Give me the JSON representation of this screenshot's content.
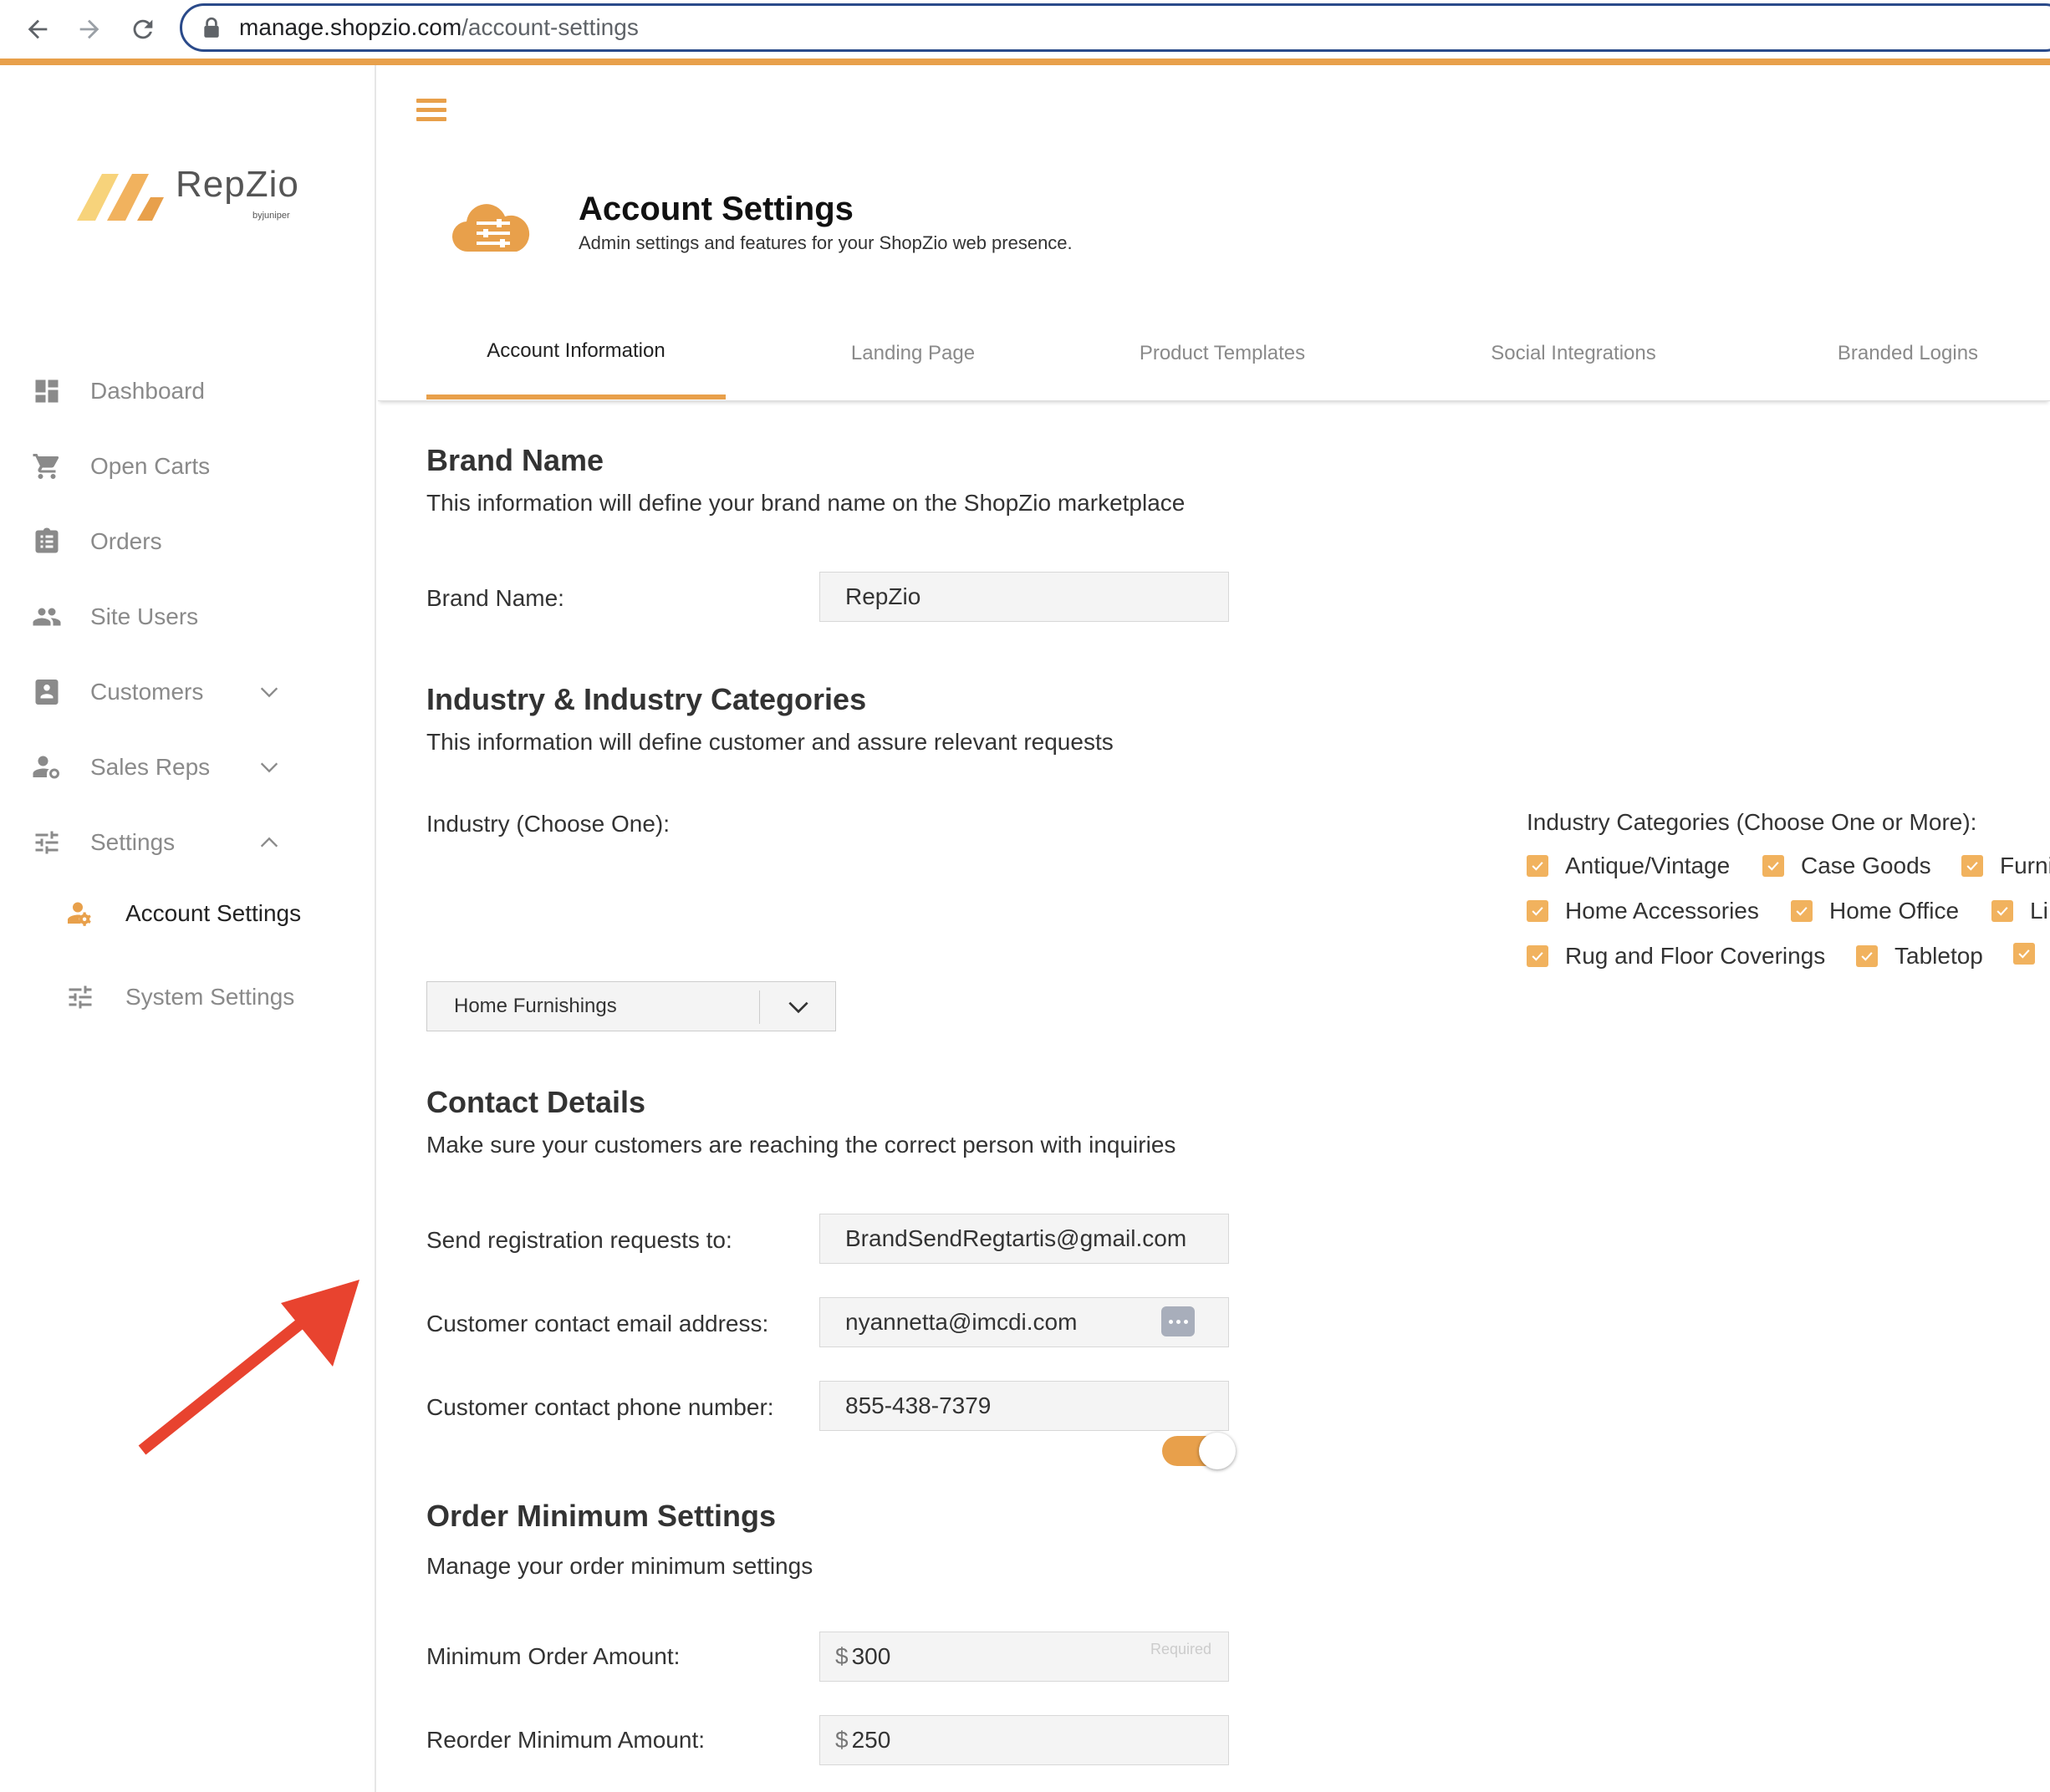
{
  "browser": {
    "url_host": "manage.shopzio.com",
    "url_path": "/account-settings"
  },
  "logo": {
    "name": "RepZio",
    "sub": "byjuniper"
  },
  "sidebar": {
    "items": [
      {
        "label": "Dashboard",
        "icon": "dashboard-icon"
      },
      {
        "label": "Open Carts",
        "icon": "cart-icon"
      },
      {
        "label": "Orders",
        "icon": "clipboard-icon"
      },
      {
        "label": "Site Users",
        "icon": "users-icon"
      },
      {
        "label": "Customers",
        "icon": "contact-book-icon",
        "expandable": true
      },
      {
        "label": "Sales Reps",
        "icon": "sales-rep-icon",
        "expandable": true
      },
      {
        "label": "Settings",
        "icon": "sliders-icon",
        "expanded": true
      }
    ],
    "sub_items": [
      {
        "label": "Account Settings",
        "icon": "user-gear-icon",
        "active": true
      },
      {
        "label": "System Settings",
        "icon": "sliders-icon"
      }
    ]
  },
  "header": {
    "title": "Account Settings",
    "subtitle": "Admin settings and features for your ShopZio web presence."
  },
  "tabs": [
    {
      "label": "Account Information",
      "active": true
    },
    {
      "label": "Landing Page"
    },
    {
      "label": "Product Templates"
    },
    {
      "label": "Social Integrations"
    },
    {
      "label": "Branded Logins"
    }
  ],
  "brand": {
    "title": "Brand Name",
    "desc": "This information will define your brand name on the ShopZio marketplace",
    "label": "Brand Name:",
    "value": "RepZio"
  },
  "industry": {
    "title": "Industry & Industry Categories",
    "desc": "This information will define customer and assure relevant requests",
    "label": "Industry (Choose One):",
    "selected": "Home Furnishings",
    "categories_label": "Industry Categories (Choose One or More):",
    "categories": [
      {
        "label": "Antique/Vintage",
        "checked": true
      },
      {
        "label": "Case Goods",
        "checked": true
      },
      {
        "label": "Furni",
        "checked": true
      },
      {
        "label": "Home Accessories",
        "checked": true
      },
      {
        "label": "Home Office",
        "checked": true
      },
      {
        "label": "Li",
        "checked": true
      },
      {
        "label": "Rug and Floor Coverings",
        "checked": true
      },
      {
        "label": "Tabletop",
        "checked": true
      },
      {
        "label": "",
        "checked": true
      }
    ]
  },
  "contact": {
    "title": "Contact Details",
    "desc": "Make sure your customers are reaching the correct person with inquiries",
    "registration_label": "Send registration requests to:",
    "registration_value": "BrandSendRegtartis@gmail.com",
    "email_label": "Customer contact email address:",
    "email_value": "nyannetta@imcdi.com",
    "phone_label": "Customer contact phone number:",
    "phone_value": "855-438-7379"
  },
  "order_min": {
    "title": "Order Minimum Settings",
    "desc": "Manage your order minimum settings",
    "enabled": true,
    "min_label": "Minimum Order Amount:",
    "currency": "$",
    "min_value": "300",
    "min_hint": "Required",
    "reorder_label": "Reorder Minimum Amount:",
    "reorder_value": "250"
  },
  "colors": {
    "accent": "#e8a04b",
    "checkbox": "#f1b25e",
    "annotation_arrow": "#e8432f"
  }
}
